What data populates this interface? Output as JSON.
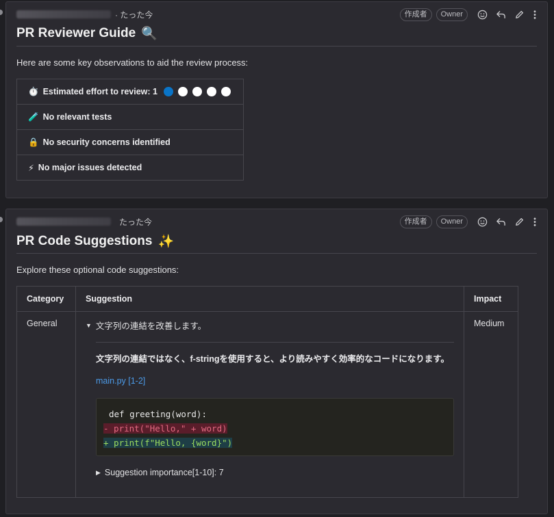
{
  "comments": [
    {
      "time": "· たった今",
      "badges": [
        "作成者",
        "Owner"
      ],
      "title": "PR Reviewer Guide",
      "title_emoji": "🔍",
      "intro": "Here are some key observations to aid the review process:",
      "rows": [
        {
          "icon": "stopwatch-icon",
          "emoji": "⏱️",
          "label": "Estimated effort to review: 1"
        },
        {
          "icon": "test-tube-icon",
          "emoji": "🧪",
          "label": "No relevant tests"
        },
        {
          "icon": "lock-icon",
          "emoji": "🔒",
          "label": "No security concerns identified"
        },
        {
          "icon": "lightning-icon",
          "emoji": "⚡",
          "label": "No major issues detected"
        }
      ],
      "effort": {
        "value": 1,
        "max": 5,
        "filled_color": "#0a74c7",
        "empty_color": "#ffffff"
      }
    },
    {
      "time": "たった今",
      "badges": [
        "作成者",
        "Owner"
      ],
      "title": "PR Code Suggestions",
      "title_emoji": "✨",
      "intro": "Explore these optional code suggestions:",
      "table": {
        "headers": [
          "Category",
          "Suggestion",
          "Impact"
        ],
        "row": {
          "category": "General",
          "summary": "文字列の連結を改善します。",
          "description": "文字列の連結ではなく、f-stringを使用すると、より読みやすく効率的なコードになります。",
          "file_link": "main.py [1-2]",
          "code": {
            "context": "def greeting(word):",
            "removed": "- print(\"Hello,\" + word)",
            "added": "+ print(f\"Hello, {word}\")"
          },
          "importance": "Suggestion importance[1-10]: 7",
          "impact": "Medium"
        }
      }
    }
  ]
}
